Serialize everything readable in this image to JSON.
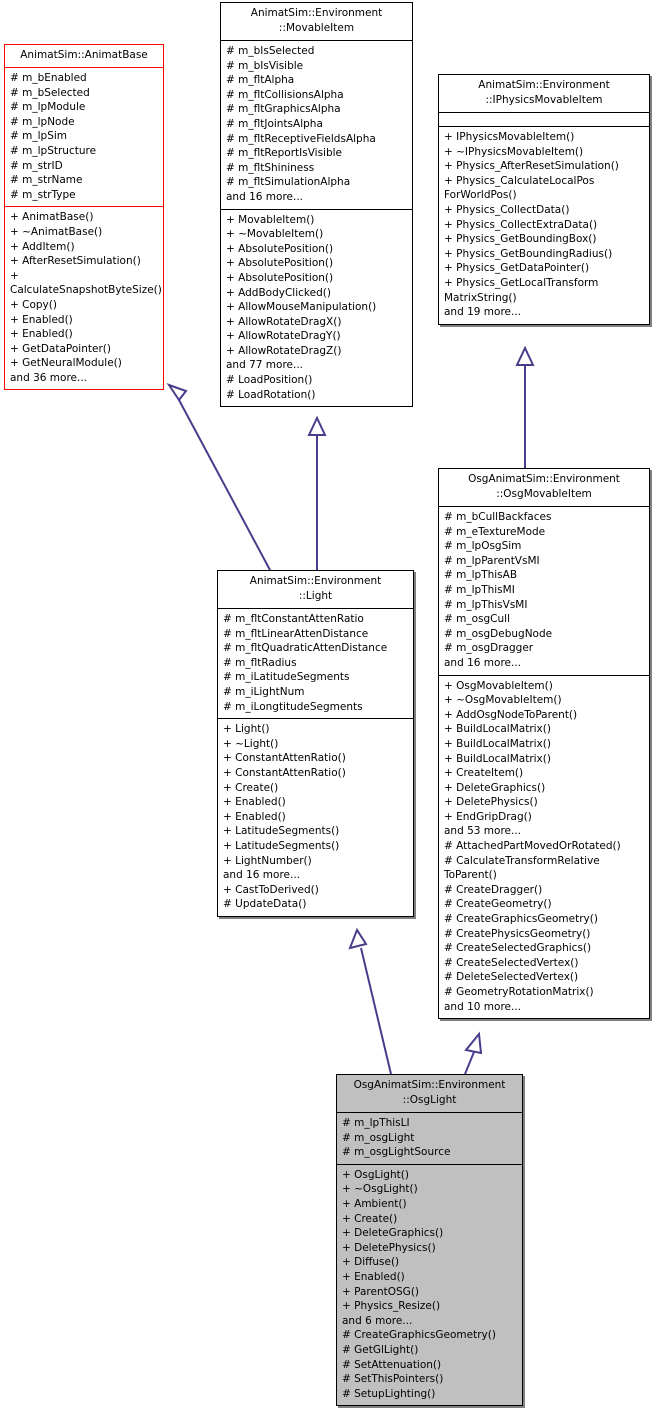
{
  "diagram": {
    "kind": "uml-class-inheritance-diagram",
    "classes": [
      {
        "id": "animatbase",
        "title": "AnimatSim::AnimatBase",
        "border_color": "#ff0000",
        "fill_color": "#ffffff",
        "attributes": [
          "# m_bEnabled",
          "# m_bSelected",
          "# m_lpModule",
          "# m_lpNode",
          "# m_lpSim",
          "# m_lpStructure",
          "# m_strID",
          "# m_strName",
          "# m_strType"
        ],
        "operations": [
          "+ AnimatBase()",
          "+ ~AnimatBase()",
          "+ AddItem()",
          "+ AfterResetSimulation()",
          "+ CalculateSnapshotByteSize()",
          "+ Copy()",
          "+ Enabled()",
          "+ Enabled()",
          "+ GetDataPointer()",
          "+ GetNeuralModule()",
          "and 36 more..."
        ]
      },
      {
        "id": "movableitem",
        "title": "AnimatSim::Environment\n::MovableItem",
        "border_color": "#000000",
        "fill_color": "#ffffff",
        "attributes": [
          "# m_bIsSelected",
          "# m_bIsVisible",
          "# m_fltAlpha",
          "# m_fltCollisionsAlpha",
          "# m_fltGraphicsAlpha",
          "# m_fltJointsAlpha",
          "# m_fltReceptiveFieldsAlpha",
          "# m_fltReportIsVisible",
          "# m_fltShininess",
          "# m_fltSimulationAlpha",
          "and 16 more..."
        ],
        "operations": [
          "+ MovableItem()",
          "+ ~MovableItem()",
          "+ AbsolutePosition()",
          "+ AbsolutePosition()",
          "+ AbsolutePosition()",
          "+ AddBodyClicked()",
          "+ AllowMouseManipulation()",
          "+ AllowRotateDragX()",
          "+ AllowRotateDragY()",
          "+ AllowRotateDragZ()",
          "and 77 more...",
          "# LoadPosition()",
          "# LoadRotation()"
        ]
      },
      {
        "id": "iphysicsmovableitem",
        "title": "AnimatSim::Environment\n::IPhysicsMovableItem",
        "border_color": "#000000",
        "fill_color": "#ffffff",
        "attributes": [],
        "operations": [
          "+ IPhysicsMovableItem()",
          "+ ~IPhysicsMovableItem()",
          "+ Physics_AfterResetSimulation()",
          "+ Physics_CalculateLocalPos\nForWorldPos()",
          "+ Physics_CollectData()",
          "+ Physics_CollectExtraData()",
          "+ Physics_GetBoundingBox()",
          "+ Physics_GetBoundingRadius()",
          "+ Physics_GetDataPointer()",
          "+ Physics_GetLocalTransform\nMatrixString()",
          "and 19 more..."
        ]
      },
      {
        "id": "osgmovableitem",
        "title": "OsgAnimatSim::Environment\n::OsgMovableItem",
        "border_color": "#000000",
        "fill_color": "#ffffff",
        "attributes": [
          "# m_bCullBackfaces",
          "# m_eTextureMode",
          "# m_lpOsgSim",
          "# m_lpParentVsMI",
          "# m_lpThisAB",
          "# m_lpThisMI",
          "# m_lpThisVsMI",
          "# m_osgCull",
          "# m_osgDebugNode",
          "# m_osgDragger",
          "and 16 more..."
        ],
        "operations": [
          "+ OsgMovableItem()",
          "+ ~OsgMovableItem()",
          "+ AddOsgNodeToParent()",
          "+ BuildLocalMatrix()",
          "+ BuildLocalMatrix()",
          "+ BuildLocalMatrix()",
          "+ CreateItem()",
          "+ DeleteGraphics()",
          "+ DeletePhysics()",
          "+ EndGripDrag()",
          "and 53 more...",
          "# AttachedPartMovedOrRotated()",
          "# CalculateTransformRelative\nToParent()",
          "# CreateDragger()",
          "# CreateGeometry()",
          "# CreateGraphicsGeometry()",
          "# CreatePhysicsGeometry()",
          "# CreateSelectedGraphics()",
          "# CreateSelectedVertex()",
          "# DeleteSelectedVertex()",
          "# GeometryRotationMatrix()",
          "and 10 more..."
        ]
      },
      {
        "id": "light",
        "title": "AnimatSim::Environment\n::Light",
        "border_color": "#000000",
        "fill_color": "#ffffff",
        "attributes": [
          "# m_fltConstantAttenRatio",
          "# m_fltLinearAttenDistance",
          "# m_fltQuadraticAttenDistance",
          "# m_fltRadius",
          "# m_iLatitudeSegments",
          "# m_iLightNum",
          "# m_iLongtitudeSegments"
        ],
        "operations": [
          "+ Light()",
          "+ ~Light()",
          "+ ConstantAttenRatio()",
          "+ ConstantAttenRatio()",
          "+ Create()",
          "+ Enabled()",
          "+ Enabled()",
          "+ LatitudeSegments()",
          "+ LatitudeSegments()",
          "+ LightNumber()",
          "and 16 more...",
          "+ CastToDerived()",
          "# UpdateData()"
        ]
      },
      {
        "id": "osglight",
        "title": "OsgAnimatSim::Environment\n::OsgLight",
        "border_color": "#000000",
        "fill_color": "#c0c0c0",
        "attributes": [
          "# m_lpThisLI",
          "# m_osgLight",
          "# m_osgLightSource"
        ],
        "operations": [
          "+ OsgLight()",
          "+ ~OsgLight()",
          "+ Ambient()",
          "+ Create()",
          "+ DeleteGraphics()",
          "+ DeletePhysics()",
          "+ Diffuse()",
          "+ Enabled()",
          "+ ParentOSG()",
          "+ Physics_Resize()",
          "and 6 more...",
          "# CreateGraphicsGeometry()",
          "# GetGlLight()",
          "# SetAttenuation()",
          "# SetThisPointers()",
          "# SetupLighting()"
        ]
      }
    ],
    "inheritance_edges": [
      {
        "from": "light",
        "to": "animatbase",
        "style": "solid-hollow-triangle"
      },
      {
        "from": "light",
        "to": "movableitem",
        "style": "solid-hollow-triangle"
      },
      {
        "from": "osgmovableitem",
        "to": "iphysicsmovableitem",
        "style": "solid-hollow-triangle"
      },
      {
        "from": "osglight",
        "to": "light",
        "style": "solid-hollow-triangle"
      },
      {
        "from": "osglight",
        "to": "osgmovableitem",
        "style": "solid-hollow-triangle"
      }
    ],
    "edge_color": "#483d8b"
  }
}
